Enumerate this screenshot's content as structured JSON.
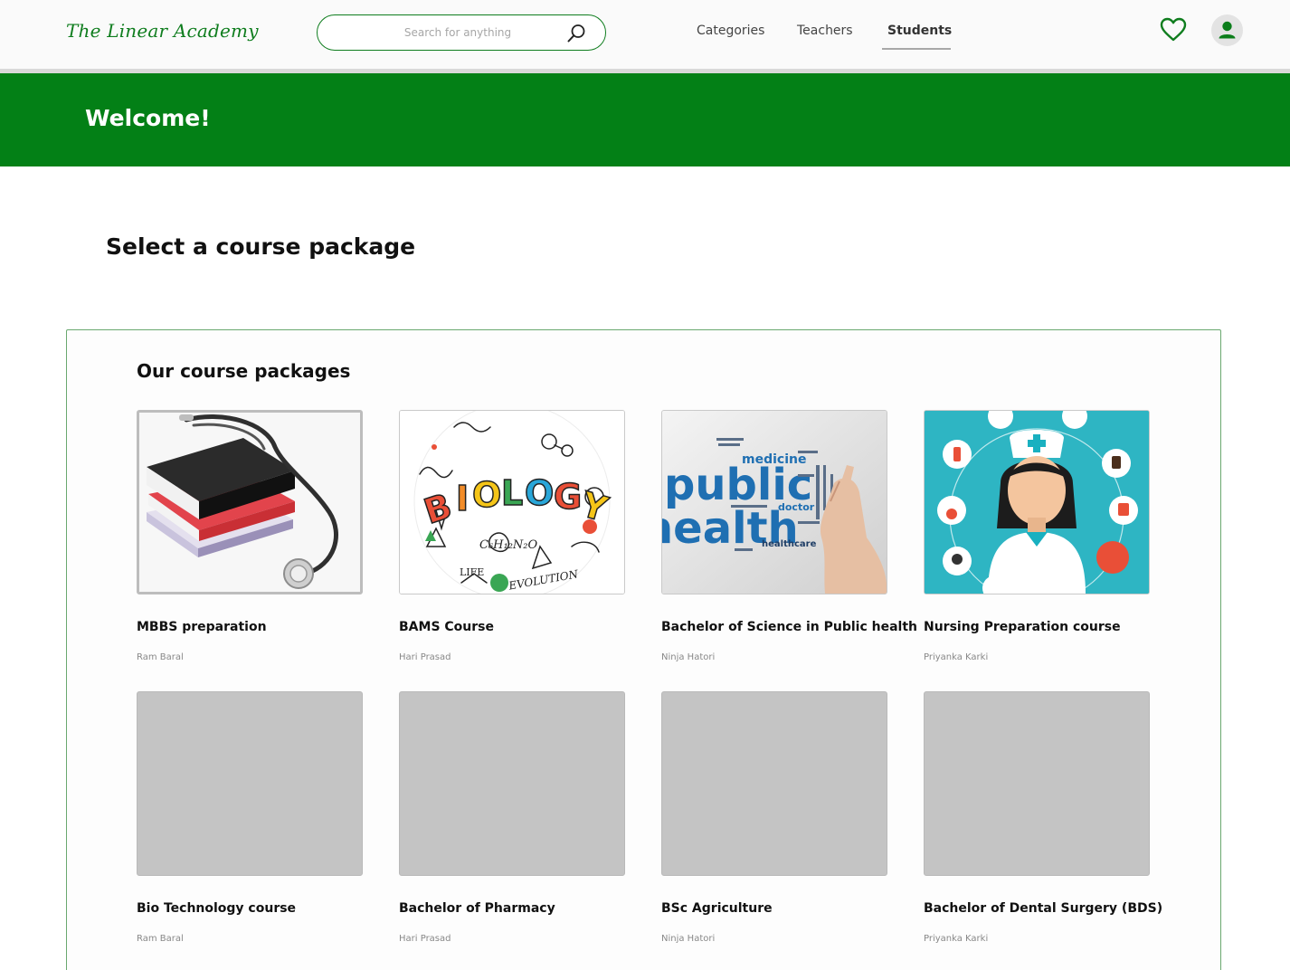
{
  "header": {
    "logo": "The Linear Academy",
    "search_placeholder": "Search for anything",
    "nav": [
      "Categories",
      "Teachers",
      "Students"
    ],
    "active_nav": "Students"
  },
  "banner": {
    "title": "Welcome!"
  },
  "page": {
    "title": "Select a course package"
  },
  "packages": {
    "title": "Our course packages",
    "items": [
      {
        "title": "MBBS preparation",
        "author": "Ram Baral",
        "image": "stethoscope-on-books"
      },
      {
        "title": "BAMS Course",
        "author": "Hari Prasad",
        "image": "biology-doodle"
      },
      {
        "title": "Bachelor of Science in Public health",
        "author": "Ninja Hatori",
        "image": "public-health-word-cloud",
        "image_text": {
          "public": "public",
          "health": "health",
          "medicine": "medicine",
          "doctor": "doctor",
          "healthcare": "healthcare"
        }
      },
      {
        "title": "Nursing Preparation course",
        "author": "Priyanka Karki",
        "image": "nurse-illustration"
      },
      {
        "title": "Bio Technology course",
        "author": "Ram Baral",
        "image": "placeholder"
      },
      {
        "title": "Bachelor of Pharmacy",
        "author": "Hari Prasad",
        "image": "placeholder"
      },
      {
        "title": "BSc Agriculture",
        "author": "Ninja Hatori",
        "image": "placeholder"
      },
      {
        "title": "Bachelor of Dental Surgery (BDS)",
        "author": "Priyanka Karki",
        "image": "placeholder"
      }
    ]
  },
  "colors": {
    "brand_green": "#038016",
    "placeholder_gray": "#c4c4c4"
  }
}
